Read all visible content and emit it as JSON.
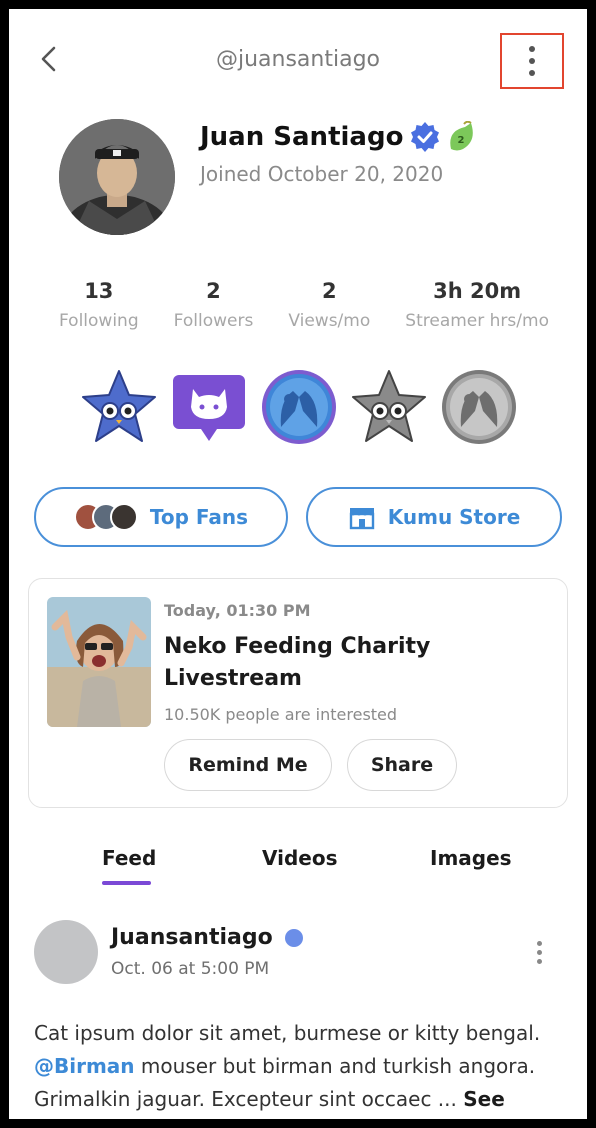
{
  "header": {
    "handle": "@juansantiago"
  },
  "profile": {
    "name": "Juan Santiago",
    "joined": "Joined October 20, 2020",
    "level_badge": "2"
  },
  "stats": [
    {
      "value": "13",
      "label": "Following"
    },
    {
      "value": "2",
      "label": "Followers"
    },
    {
      "value": "2",
      "label": "Views/mo"
    },
    {
      "value": "3h 20m",
      "label": "Streamer hrs/mo"
    }
  ],
  "badges": [
    "star-owl-badge-blue",
    "cat-chat-badge-purple",
    "high-five-badge-blue",
    "star-owl-badge-gray",
    "high-five-badge-gray"
  ],
  "actions": {
    "top_fans": "Top Fans",
    "kumu_store": "Kumu Store"
  },
  "event": {
    "time": "Today, 01:30 PM",
    "title": "Neko Feeding Charity Livestream",
    "interest": "10.50K people are interested",
    "remind_label": "Remind Me",
    "share_label": "Share"
  },
  "tabs": [
    "Feed",
    "Videos",
    "Images"
  ],
  "post": {
    "author": "Juansantiago",
    "date": "Oct. 06 at 5:00 PM",
    "text_1": "Cat ipsum dolor sit amet, burmese or kitty bengal.",
    "mention": "@Birman",
    "text_2": " mouser but birman and turkish angora. Grimalkin jaguar. Excepteur sint occaec ... ",
    "see_more": "See more"
  },
  "colors": {
    "accent": "#3d8ad6",
    "tab_underline": "#7b49d6",
    "verified": "#4a6fe0",
    "highlight_box": "#e2452f"
  }
}
